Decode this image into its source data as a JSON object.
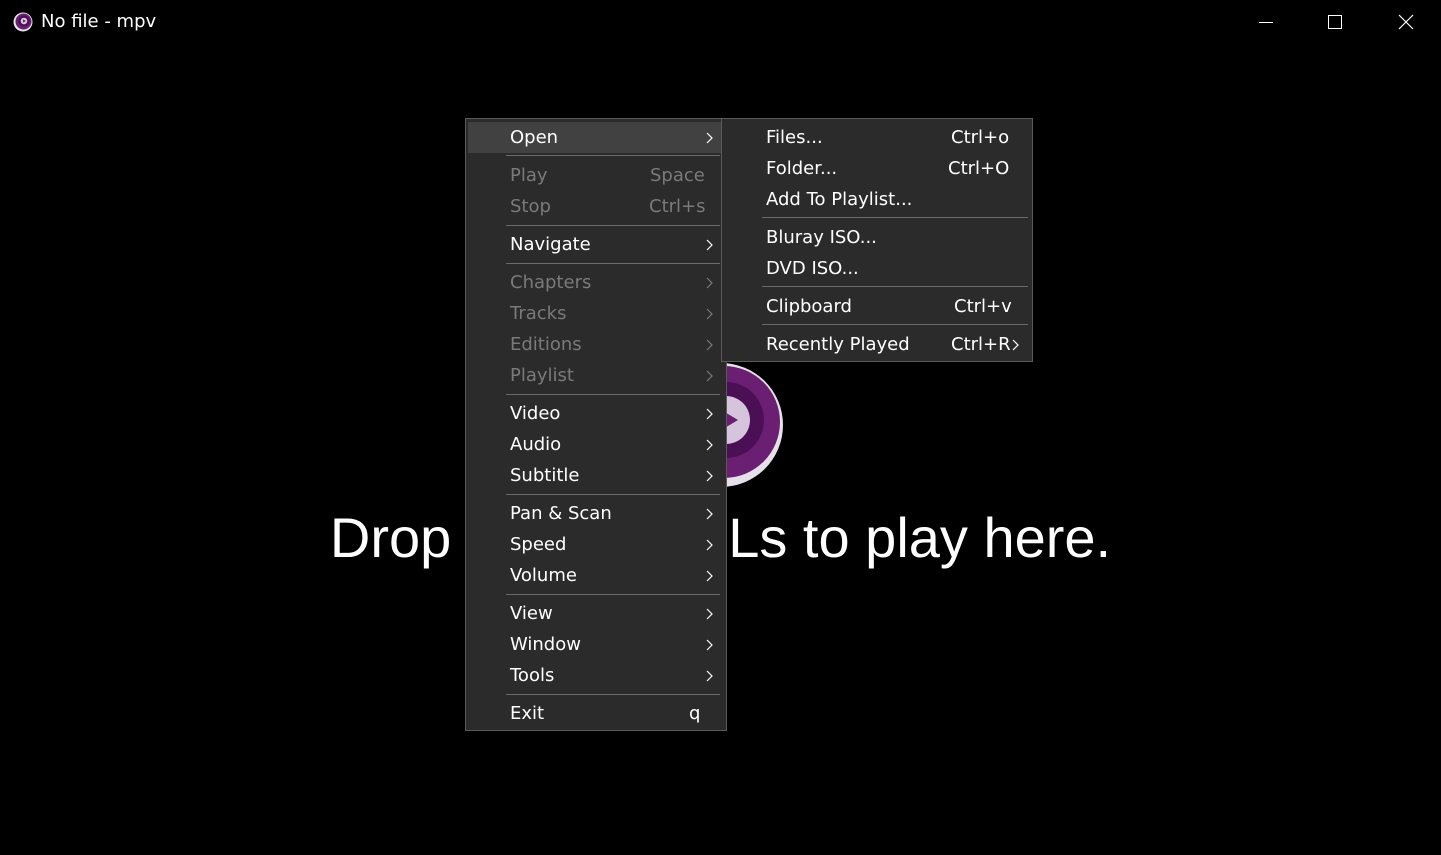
{
  "window": {
    "title": "No file - mpv",
    "icon": "mpv-logo-icon",
    "controls": {
      "minimize": "minimize-icon",
      "maximize": "maximize-icon",
      "close": "close-icon"
    }
  },
  "player": {
    "drop_message": "Drop files or URLs to play here.",
    "logo": "mpv-logo-icon"
  },
  "main_menu": {
    "items": [
      {
        "label": "Open",
        "shortcut": "",
        "submenu": true,
        "enabled": true,
        "highlighted": true
      },
      {
        "label": "Play",
        "shortcut": "Space",
        "submenu": false,
        "enabled": false
      },
      {
        "label": "Stop",
        "shortcut": "Ctrl+s",
        "submenu": false,
        "enabled": false
      },
      {
        "label": "Navigate",
        "shortcut": "",
        "submenu": true,
        "enabled": true
      },
      {
        "label": "Chapters",
        "shortcut": "",
        "submenu": true,
        "enabled": false
      },
      {
        "label": "Tracks",
        "shortcut": "",
        "submenu": true,
        "enabled": false
      },
      {
        "label": "Editions",
        "shortcut": "",
        "submenu": true,
        "enabled": false
      },
      {
        "label": "Playlist",
        "shortcut": "",
        "submenu": true,
        "enabled": false
      },
      {
        "label": "Video",
        "shortcut": "",
        "submenu": true,
        "enabled": true
      },
      {
        "label": "Audio",
        "shortcut": "",
        "submenu": true,
        "enabled": true
      },
      {
        "label": "Subtitle",
        "shortcut": "",
        "submenu": true,
        "enabled": true
      },
      {
        "label": "Pan & Scan",
        "shortcut": "",
        "submenu": true,
        "enabled": true
      },
      {
        "label": "Speed",
        "shortcut": "",
        "submenu": true,
        "enabled": true
      },
      {
        "label": "Volume",
        "shortcut": "",
        "submenu": true,
        "enabled": true
      },
      {
        "label": "View",
        "shortcut": "",
        "submenu": true,
        "enabled": true
      },
      {
        "label": "Window",
        "shortcut": "",
        "submenu": true,
        "enabled": true
      },
      {
        "label": "Tools",
        "shortcut": "",
        "submenu": true,
        "enabled": true
      },
      {
        "label": "Exit",
        "shortcut": "q",
        "submenu": false,
        "enabled": true
      }
    ]
  },
  "open_submenu": {
    "items": [
      {
        "label": "Files...",
        "shortcut": "Ctrl+o",
        "submenu": false
      },
      {
        "label": "Folder...",
        "shortcut": "Ctrl+O",
        "submenu": false
      },
      {
        "label": "Add To Playlist...",
        "shortcut": "",
        "submenu": false
      },
      {
        "label": "Bluray ISO...",
        "shortcut": "",
        "submenu": false
      },
      {
        "label": "DVD ISO...",
        "shortcut": "",
        "submenu": false
      },
      {
        "label": "Clipboard",
        "shortcut": "Ctrl+v",
        "submenu": false
      },
      {
        "label": "Recently Played",
        "shortcut": "Ctrl+R",
        "submenu": true
      }
    ]
  },
  "colors": {
    "background": "#000000",
    "menu_bg": "#2b2b2b",
    "menu_highlight": "#414141",
    "menu_disabled_text": "#7a7a7a",
    "logo_purple": "#6b1f73"
  }
}
